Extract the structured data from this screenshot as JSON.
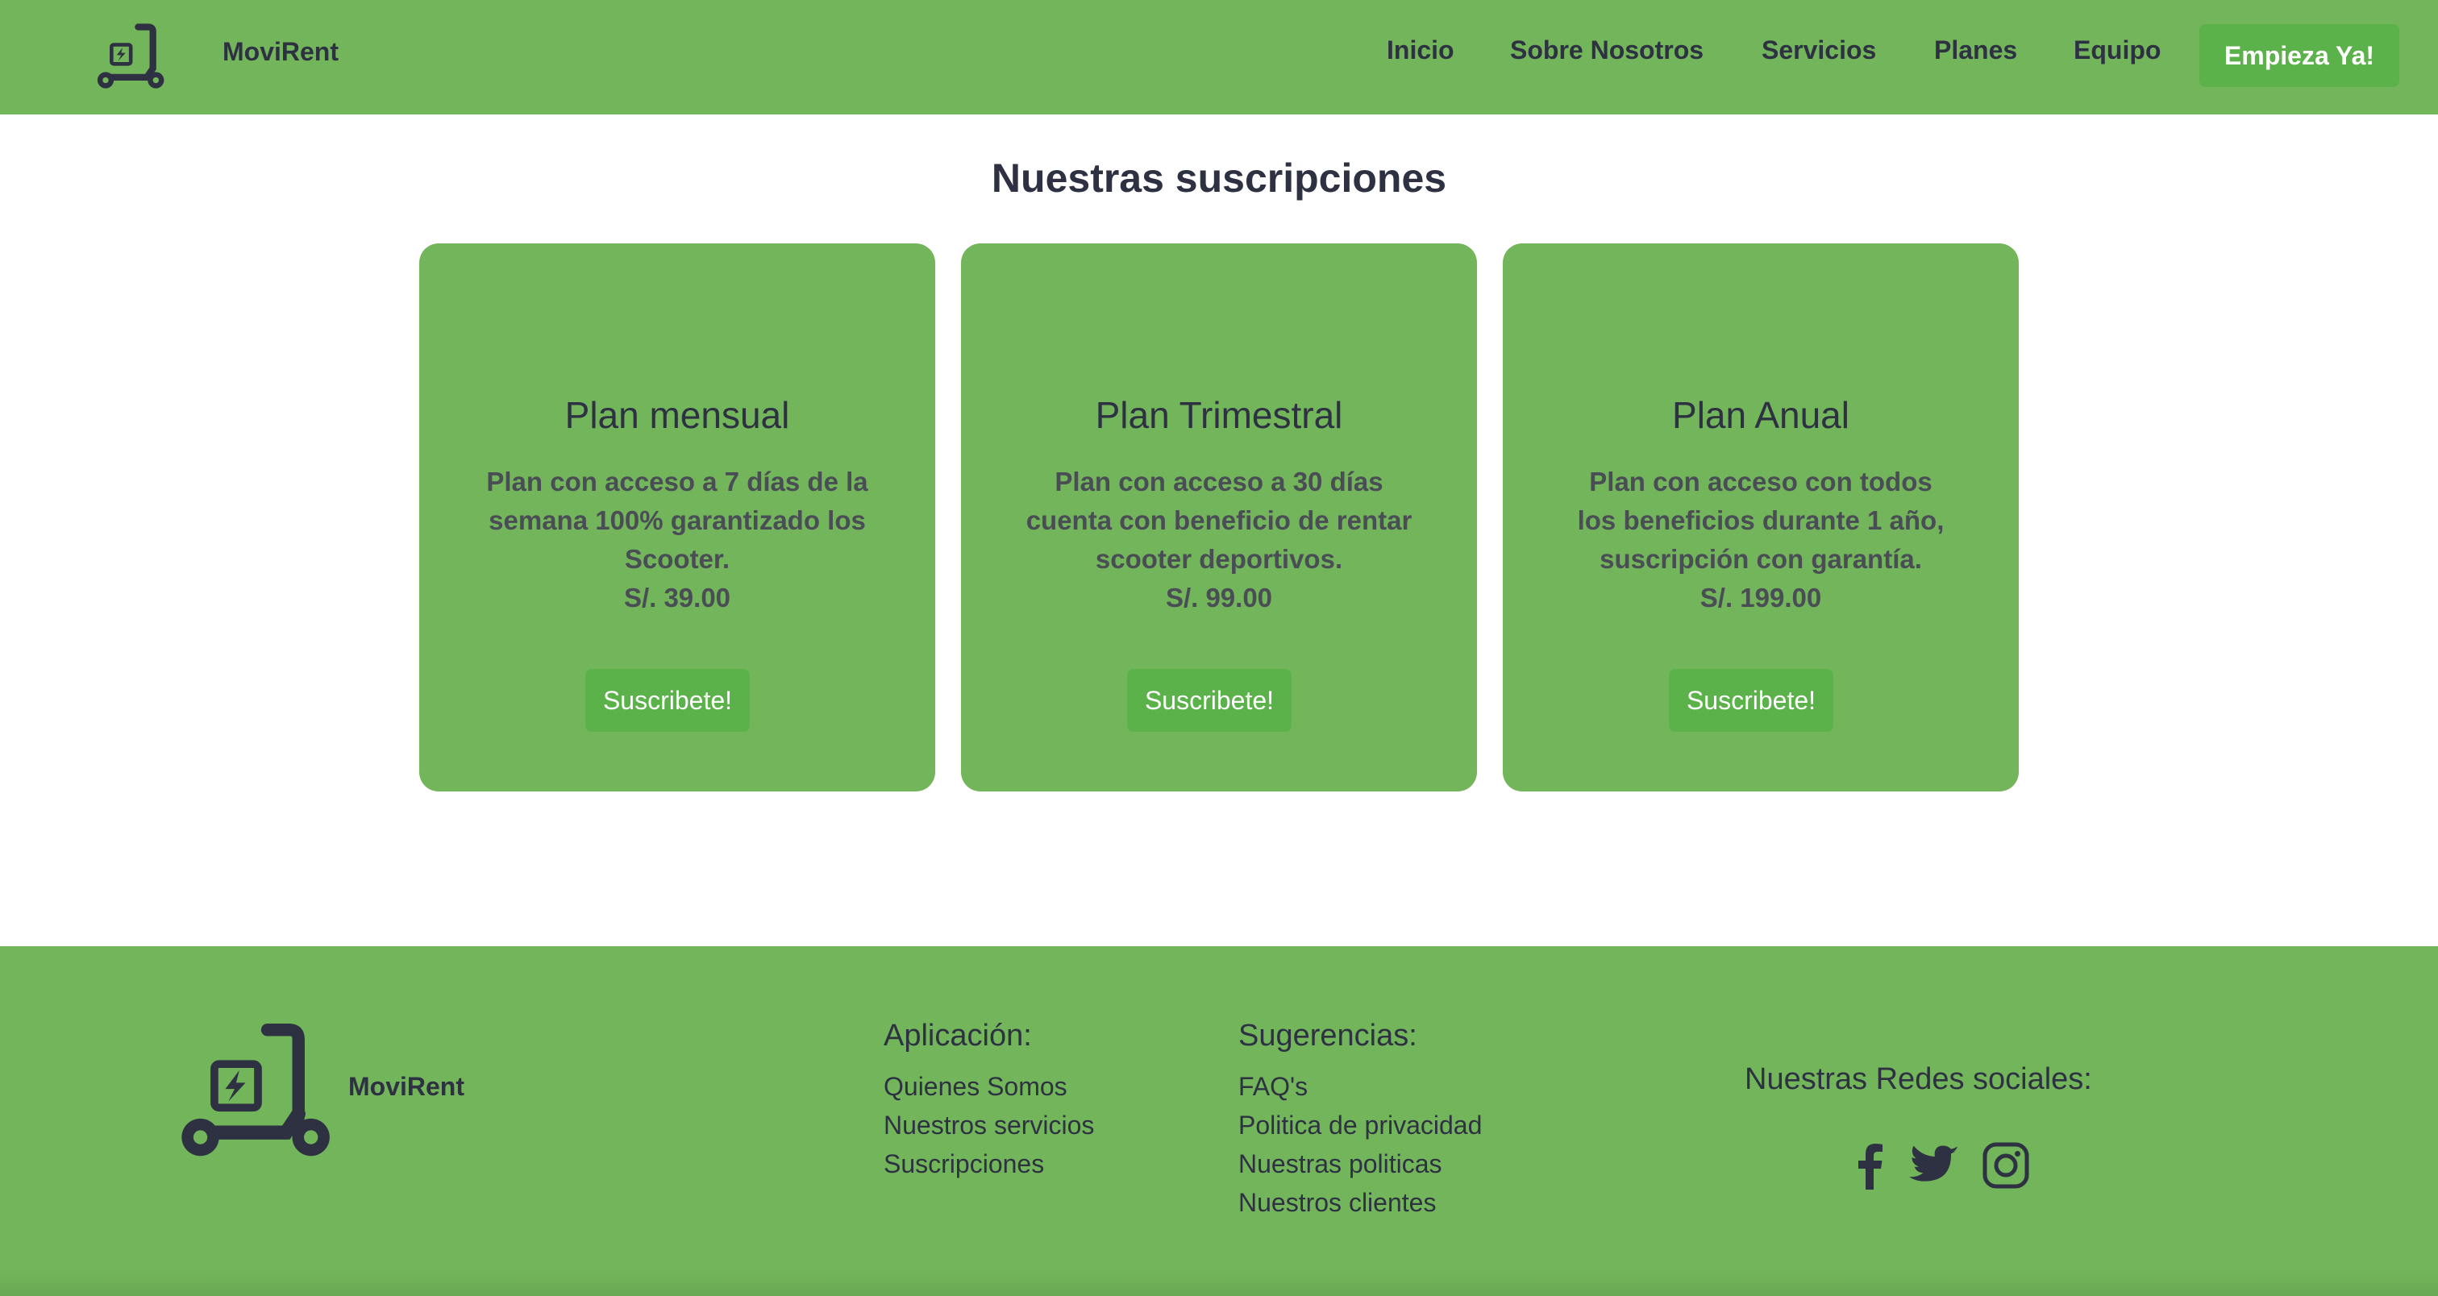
{
  "brand": {
    "name": "MoviRent"
  },
  "nav": {
    "links": [
      "Inicio",
      "Sobre Nosotros",
      "Servicios",
      "Planes",
      "Equipo"
    ],
    "cta": "Empieza Ya!"
  },
  "plans": {
    "title": "Nuestras suscripciones",
    "items": [
      {
        "name": "Plan mensual",
        "description": "Plan con acceso a 7 días de la semana 100% garantizado los Scooter.",
        "price": "S/. 39.00",
        "button": "Suscribete!"
      },
      {
        "name": "Plan Trimestral",
        "description": "Plan con acceso a 30 días cuenta con beneficio de rentar scooter deportivos.",
        "price": "S/. 99.00",
        "button": "Suscribete!"
      },
      {
        "name": "Plan Anual",
        "description": "Plan con acceso con todos los beneficios durante 1 año, suscripción con garantía.",
        "price": "S/. 199.00",
        "button": "Suscribete!"
      }
    ]
  },
  "footer": {
    "brand": "MoviRent",
    "app": {
      "title": "Aplicación:",
      "links": [
        "Quienes Somos",
        "Nuestros servicios",
        "Suscripciones"
      ]
    },
    "suggestions": {
      "title": "Sugerencias:",
      "links": [
        "FAQ's",
        "Politica de privacidad",
        "Nuestras politicas",
        "Nuestros clientes"
      ]
    },
    "social": {
      "title": "Nuestras Redes sociales:",
      "icons": [
        "facebook-icon",
        "twitter-icon",
        "instagram-icon"
      ]
    }
  },
  "colors": {
    "primary_green": "#72b55a",
    "button_green": "#5cb24a",
    "dark_text": "#2e3142"
  }
}
